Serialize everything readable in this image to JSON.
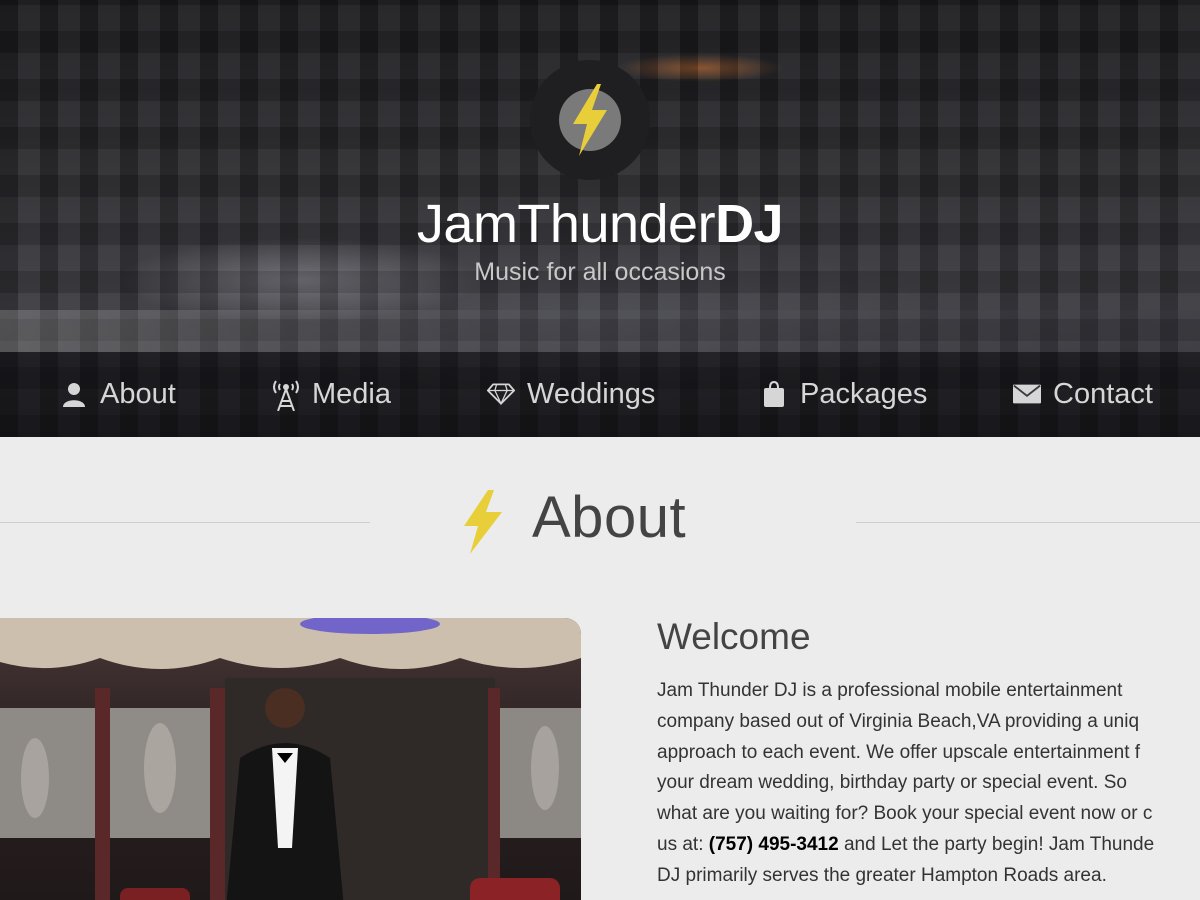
{
  "header": {
    "title_main": "JamThunder",
    "title_bold": "DJ",
    "tagline": "Music for all occasions"
  },
  "nav": {
    "items": [
      {
        "label": "About",
        "icon": "user-icon"
      },
      {
        "label": "Media",
        "icon": "broadcast-tower-icon"
      },
      {
        "label": "Weddings",
        "icon": "diamond-icon"
      },
      {
        "label": "Packages",
        "icon": "shopping-bag-icon"
      },
      {
        "label": "Contact",
        "icon": "envelope-icon"
      }
    ]
  },
  "about": {
    "section_title": "About",
    "welcome_heading": "Welcome",
    "body_lines": [
      "Jam Thunder DJ is a professional mobile entertainment",
      "company based out of Virginia Beach,VA providing a uniq",
      "approach to each event. We offer upscale entertainment f",
      "your dream wedding, birthday party or special event. So",
      "what are you waiting for? Book your special event now or c"
    ],
    "line6_prefix": "us at: ",
    "phone": "(757) 495-3412",
    "line6_suffix": " and Let the party begin! Jam Thunde",
    "line7": "DJ primarily serves the greater Hampton Roads area."
  },
  "colors": {
    "accent_yellow": "#e8cf3a",
    "page_background": "#ececec",
    "text_dark": "#333333"
  }
}
